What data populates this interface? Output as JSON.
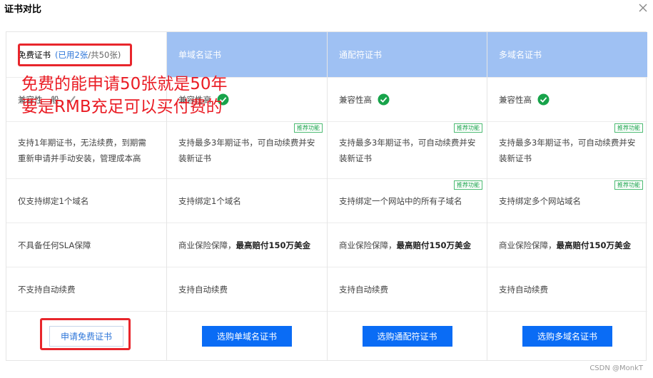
{
  "dialog": {
    "title": "证书对比",
    "close_icon": "close-icon"
  },
  "columns": [
    {
      "header": "免费证书",
      "used": "(已用2张",
      "total": "/共50张)",
      "compat": "兼容性一般",
      "period": "支持1年期证书，无法续费，到期需重新申请并手动安装，管理成本高",
      "domain": "仅支持绑定1个域名",
      "sla": "不具备任何SLA保障",
      "renew": "不支持自动续费",
      "button": "申请免费证书"
    },
    {
      "header": "单域名证书",
      "compat": "兼容性高",
      "period_tag": "推荐功能",
      "period": "支持最多3年期证书，可自动续费并安装新证书",
      "domain": "支持绑定1个域名",
      "sla_prefix": "商业保险保障，",
      "sla_bold": "最高赔付150万美金",
      "renew": "支持自动续费",
      "button": "选购单域名证书"
    },
    {
      "header": "通配符证书",
      "compat": "兼容性高",
      "period_tag": "推荐功能",
      "period": "支持最多3年期证书，可自动续费并安装新证书",
      "domain_tag": "推荐功能",
      "domain": "支持绑定一个网站中的所有子域名",
      "sla_prefix": "商业保险保障，",
      "sla_bold": "最高赔付150万美金",
      "renew": "支持自动续费",
      "button": "选购通配符证书"
    },
    {
      "header": "多域名证书",
      "compat": "兼容性高",
      "period_tag": "推荐功能",
      "period": "支持最多3年期证书，可自动续费并安装新证书",
      "domain_tag": "推荐功能",
      "domain": "支持绑定多个网站域名",
      "sla_prefix": "商业保险保障，",
      "sla_bold": "最高赔付150万美金",
      "renew": "支持自动续费",
      "button": "选购多域名证书"
    }
  ],
  "annotation": {
    "line1": "免费的能申请50张就是50年",
    "line2": "要是RMB充足可以买付费的",
    "color": "#ea1c24"
  },
  "watermark": "CSDN @MonkT",
  "colors": {
    "header_blue": "#9fc1f3",
    "primary_button": "#0a6cf5",
    "check_green": "#17a34a",
    "link_blue": "#2e76d9"
  }
}
